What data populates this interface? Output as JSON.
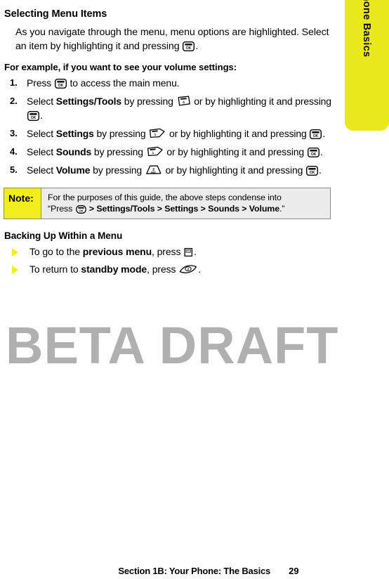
{
  "side_tab": {
    "label": "Phone Basics",
    "color": "#e9e81c"
  },
  "watermark": {
    "text": "BETA DRAFT",
    "color": "#b0b0b0"
  },
  "section": {
    "heading": "Selecting Menu Items",
    "intro_part1": "As you navigate through the menu, menu options are highlighted. Select an item by highlighting it and pressing ",
    "intro_part2": ".",
    "example_line": "For example, if you want to see your volume settings:"
  },
  "steps": [
    {
      "number": "1.",
      "pre": "Press ",
      "key1": "ok-key",
      "mid": " to access the main menu.",
      "bold": "",
      "post": "",
      "key2": ""
    },
    {
      "number": "2.",
      "pre": "Select ",
      "bold": "Settings/Tools",
      "mid": " by pressing ",
      "key1": "key-4",
      "post": " or by highlighting it and pressing ",
      "key2": "ok-key",
      "end": "."
    },
    {
      "number": "3.",
      "pre": "Select ",
      "bold": "Settings",
      "mid": " by pressing ",
      "key1": "key-1",
      "post": " or by highlighting it and pressing ",
      "key2": "ok-key",
      "end": "."
    },
    {
      "number": "4.",
      "pre": "Select ",
      "bold": "Sounds",
      "mid": " by pressing ",
      "key1": "key-1",
      "post": " or by highlighting it and pressing ",
      "key2": "ok-key",
      "end": "."
    },
    {
      "number": "5.",
      "pre": "Select ",
      "bold": "Volume",
      "mid": " by pressing ",
      "key1": "key-2-abc",
      "post": " or by highlighting it and pressing ",
      "key2": "ok-key",
      "end": "."
    }
  ],
  "note": {
    "label": "Note:",
    "line1": "For the purposes of this guide, the above steps condense into",
    "quote_open": "“Press ",
    "key": "ok-key",
    "path": " > Settings/Tools > Settings > Sounds > Volume",
    "quote_close": ".”"
  },
  "subsection": {
    "heading": "Backing Up Within a Menu",
    "bullets": [
      {
        "pre": "To go to the ",
        "bold": "previous menu",
        "mid": ", press ",
        "key": "back-key",
        "end": "."
      },
      {
        "pre": "To return to ",
        "bold": "standby mode",
        "mid": ", press ",
        "key": "end-key",
        "end": "."
      }
    ]
  },
  "footer": {
    "text": "Section 1B: Your Phone: The Basics",
    "page": "29"
  }
}
